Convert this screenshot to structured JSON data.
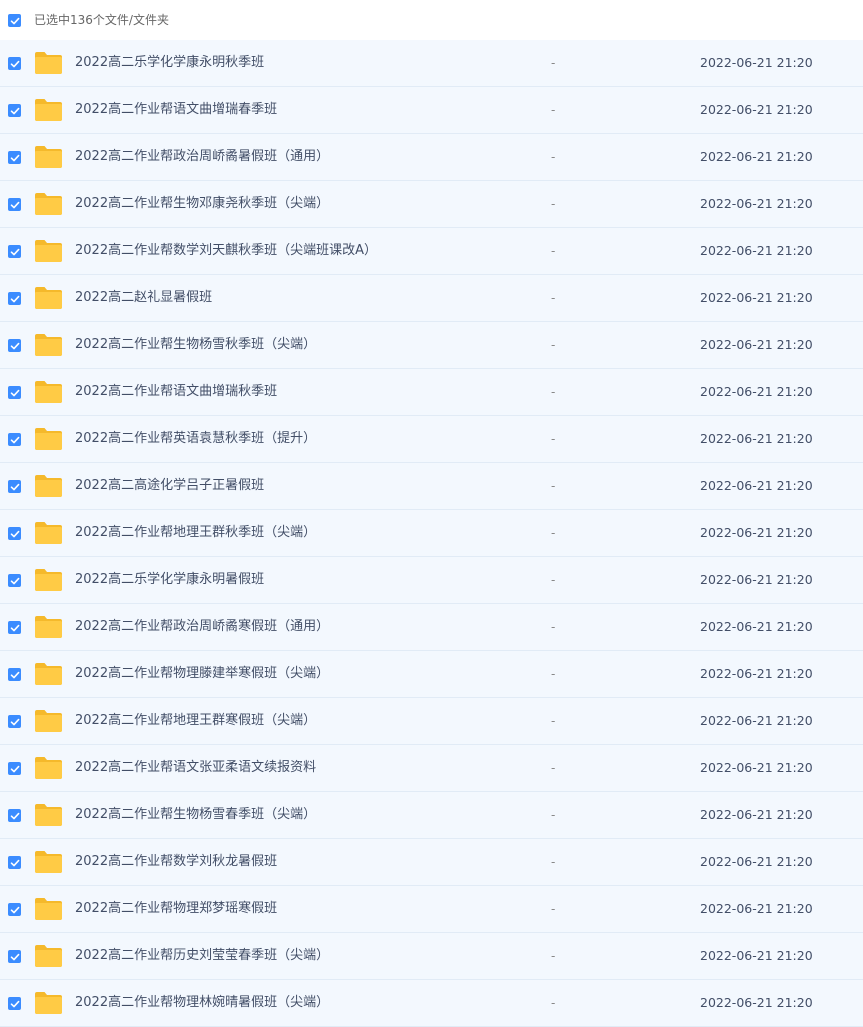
{
  "header": {
    "selection_text": "已选中136个文件/文件夹"
  },
  "colors": {
    "checkbox": "#3b8cff",
    "folder": "#ffc93f",
    "row_bg": "#f3f8fe"
  },
  "files": [
    {
      "name": "2022高二乐学化学康永明秋季班",
      "size": "-",
      "date": "2022-06-21 21:20"
    },
    {
      "name": "2022高二作业帮语文曲增瑞春季班",
      "size": "-",
      "date": "2022-06-21 21:20"
    },
    {
      "name": "2022高二作业帮政治周峤矞暑假班（通用）",
      "size": "-",
      "date": "2022-06-21 21:20"
    },
    {
      "name": "2022高二作业帮生物邓康尧秋季班（尖端）",
      "size": "-",
      "date": "2022-06-21 21:20"
    },
    {
      "name": "2022高二作业帮数学刘天麒秋季班（尖端班课改A）",
      "size": "-",
      "date": "2022-06-21 21:20"
    },
    {
      "name": "2022高二赵礼显暑假班",
      "size": "-",
      "date": "2022-06-21 21:20"
    },
    {
      "name": "2022高二作业帮生物杨雪秋季班（尖端）",
      "size": "-",
      "date": "2022-06-21 21:20"
    },
    {
      "name": "2022高二作业帮语文曲增瑞秋季班",
      "size": "-",
      "date": "2022-06-21 21:20"
    },
    {
      "name": "2022高二作业帮英语袁慧秋季班（提升）",
      "size": "-",
      "date": "2022-06-21 21:20"
    },
    {
      "name": "2022高二高途化学吕子正暑假班",
      "size": "-",
      "date": "2022-06-21 21:20"
    },
    {
      "name": "2022高二作业帮地理王群秋季班（尖端）",
      "size": "-",
      "date": "2022-06-21 21:20"
    },
    {
      "name": "2022高二乐学化学康永明暑假班",
      "size": "-",
      "date": "2022-06-21 21:20"
    },
    {
      "name": "2022高二作业帮政治周峤矞寒假班（通用）",
      "size": "-",
      "date": "2022-06-21 21:20"
    },
    {
      "name": "2022高二作业帮物理滕建举寒假班（尖端）",
      "size": "-",
      "date": "2022-06-21 21:20"
    },
    {
      "name": "2022高二作业帮地理王群寒假班（尖端）",
      "size": "-",
      "date": "2022-06-21 21:20"
    },
    {
      "name": "2022高二作业帮语文张亚柔语文续报资料",
      "size": "-",
      "date": "2022-06-21 21:20"
    },
    {
      "name": "2022高二作业帮生物杨雪春季班（尖端）",
      "size": "-",
      "date": "2022-06-21 21:20"
    },
    {
      "name": "2022高二作业帮数学刘秋龙暑假班",
      "size": "-",
      "date": "2022-06-21 21:20"
    },
    {
      "name": "2022高二作业帮物理郑梦瑶寒假班",
      "size": "-",
      "date": "2022-06-21 21:20"
    },
    {
      "name": "2022高二作业帮历史刘莹莹春季班（尖端）",
      "size": "-",
      "date": "2022-06-21 21:20"
    },
    {
      "name": "2022高二作业帮物理林婉晴暑假班（尖端）",
      "size": "-",
      "date": "2022-06-21 21:20"
    }
  ]
}
